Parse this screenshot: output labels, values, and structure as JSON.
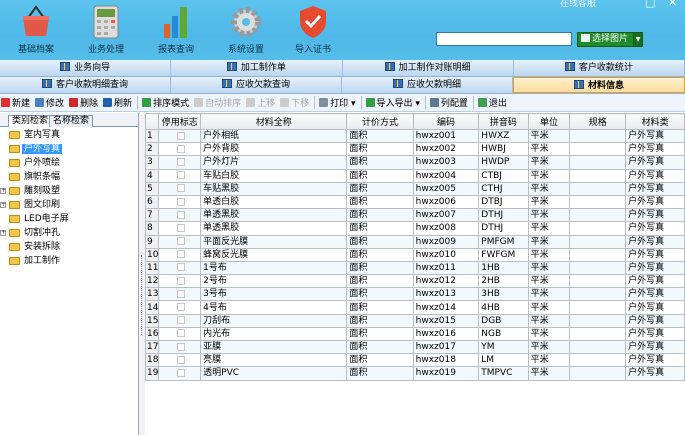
{
  "header": {
    "buttons": [
      {
        "label": "基础档案",
        "icon": "basket-icon"
      },
      {
        "label": "业务处理",
        "icon": "calculator-icon"
      },
      {
        "label": "报表查询",
        "icon": "bar-chart-icon"
      },
      {
        "label": "系统设置",
        "icon": "gear-icon"
      },
      {
        "label": "导入证书",
        "icon": "shield-icon"
      }
    ],
    "online_service": "在线客服",
    "search_value": "",
    "pick_image": "选择图片"
  },
  "tabs_row1": [
    "业务向导",
    "加工制作单",
    "加工制作对账明细",
    "客户收款统计"
  ],
  "tabs_row2": [
    "客户收款明细查询",
    "应收欠款查询",
    "应收欠款明细",
    "材料信息"
  ],
  "active_tab": "材料信息",
  "toolbar": [
    {
      "label": "新建",
      "color": "#e03030"
    },
    {
      "label": "修改",
      "color": "#4a7fc0"
    },
    {
      "label": "删除",
      "color": "#d02828"
    },
    {
      "label": "刷新",
      "color": "#2060b0"
    },
    {
      "label": "排序模式",
      "color": "#30a040"
    },
    {
      "label": "自动排序",
      "disabled": true
    },
    {
      "label": "上移",
      "disabled": true
    },
    {
      "label": "下移",
      "disabled": true
    },
    {
      "label": "打印 ▾",
      "color": "#8090a0"
    },
    {
      "label": "导入导出 ▾",
      "color": "#30a040"
    },
    {
      "label": "列配置",
      "color": "#607890"
    },
    {
      "label": "退出",
      "color": "#40a050"
    }
  ],
  "left_tabs": [
    "类别检索",
    "名称检索"
  ],
  "tree": [
    {
      "label": "室内写真"
    },
    {
      "label": "户外写真",
      "selected": true
    },
    {
      "label": "户外喷绘"
    },
    {
      "label": "旗帜条幅"
    },
    {
      "label": "雕刻吸塑",
      "expandable": true
    },
    {
      "label": "图文印刷",
      "expandable": true
    },
    {
      "label": "LED电子屏"
    },
    {
      "label": "切割冲孔",
      "expandable": true
    },
    {
      "label": "安装拆除"
    },
    {
      "label": "加工制作"
    }
  ],
  "columns": [
    "",
    "停用标志",
    "材料全称",
    "计价方式",
    "编码",
    "拼音码",
    "单位",
    "规格",
    "材料类"
  ],
  "rows": [
    [
      "1",
      "户外相纸",
      "面积",
      "hwxz001",
      "HWXZ",
      "平米",
      "",
      "户外写真"
    ],
    [
      "2",
      "户外背胶",
      "面积",
      "hwxz002",
      "HWBJ",
      "平米",
      "",
      "户外写真"
    ],
    [
      "3",
      "户外灯片",
      "面积",
      "hwxz003",
      "HWDP",
      "平米",
      "",
      "户外写真"
    ],
    [
      "4",
      "车贴白胶",
      "面积",
      "hwxz004",
      "CTBJ",
      "平米",
      "",
      "户外写真"
    ],
    [
      "5",
      "车贴黑胶",
      "面积",
      "hwxz005",
      "CTHJ",
      "平米",
      "",
      "户外写真"
    ],
    [
      "6",
      "单透白胶",
      "面积",
      "hwxz006",
      "DTBJ",
      "平米",
      "",
      "户外写真"
    ],
    [
      "7",
      "单透黑胶",
      "面积",
      "hwxz007",
      "DTHJ",
      "平米",
      "",
      "户外写真"
    ],
    [
      "8",
      "单透黑胶",
      "面积",
      "hwxz008",
      "DTHJ",
      "平米",
      "",
      "户外写真"
    ],
    [
      "9",
      "平面反光膜",
      "面积",
      "hwxz009",
      "PMFGM",
      "平米",
      "",
      "户外写真"
    ],
    [
      "10",
      "蜂窝反光膜",
      "面积",
      "hwxz010",
      "FWFGM",
      "平米",
      "",
      "户外写真"
    ],
    [
      "11",
      "1号布",
      "面积",
      "hwxz011",
      "1HB",
      "平米",
      "",
      "户外写真"
    ],
    [
      "12",
      "2号布",
      "面积",
      "hwxz012",
      "2HB",
      "平米",
      "",
      "户外写真"
    ],
    [
      "13",
      "3号布",
      "面积",
      "hwxz013",
      "3HB",
      "平米",
      "",
      "户外写真"
    ],
    [
      "14",
      "4号布",
      "面积",
      "hwxz014",
      "4HB",
      "平米",
      "",
      "户外写真"
    ],
    [
      "15",
      "刀刮布",
      "面积",
      "hwxz015",
      "DGB",
      "平米",
      "",
      "户外写真"
    ],
    [
      "16",
      "内光布",
      "面积",
      "hwxz016",
      "NGB",
      "平米",
      "",
      "户外写真"
    ],
    [
      "17",
      "亚膜",
      "面积",
      "hwxz017",
      "YM",
      "平米",
      "",
      "户外写真"
    ],
    [
      "18",
      "亮膜",
      "面积",
      "hwxz018",
      "LM",
      "平米",
      "",
      "户外写真"
    ],
    [
      "19",
      "透明PVC",
      "面积",
      "hwxz019",
      "TMPVC",
      "平米",
      "",
      "户外写真"
    ]
  ]
}
